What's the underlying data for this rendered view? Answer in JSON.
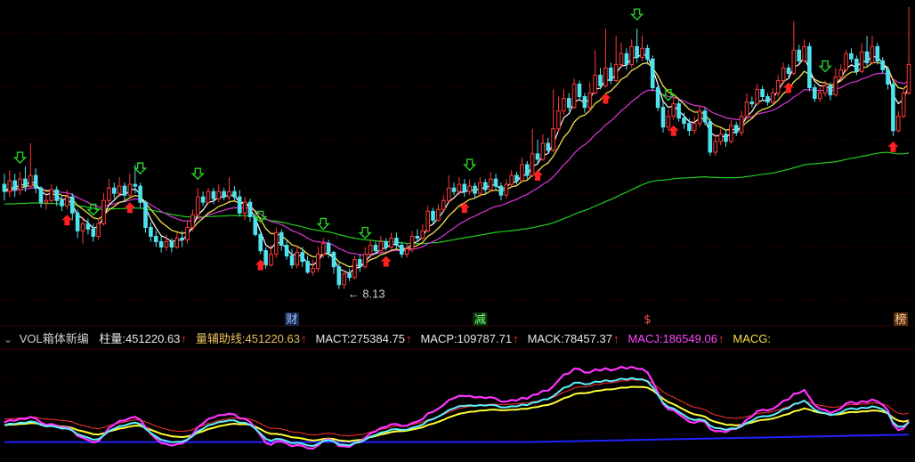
{
  "colors": {
    "background": "#000000",
    "grid": "#5a0000",
    "up_candle": "#ff3a3a",
    "down_candle": "#4fe3f0",
    "ma_short": "#ffffff",
    "ma_mid": "#f2e04a",
    "ma_long": "#cc33cc",
    "ma_longest": "#22cc22",
    "buy_arrow": "#ff2020",
    "sell_arrow": "#28d028",
    "macd_t": "#ff3030",
    "macd_p": "#ff33ff",
    "macd_k": "#5ff0ff",
    "macd_j": "#ffff33",
    "macd_g": "#2222ff"
  },
  "info_bar": {
    "toggle_icon": "chevron-down-icon",
    "indicator_name": "VOL箱体新编",
    "fields": [
      {
        "label": "柱量: ",
        "value": "451220.63",
        "color": "#e8e8e8",
        "arrow": "↑"
      },
      {
        "label": "量辅助线: ",
        "value": "451220.63",
        "color": "#e8c060",
        "arrow": "↑"
      },
      {
        "label": "MACT: ",
        "value": "275384.75",
        "color": "#e8e8e8",
        "arrow": "↑"
      },
      {
        "label": "MACP: ",
        "value": "109787.71",
        "color": "#e8e8e8",
        "arrow": "↑"
      },
      {
        "label": "MACK: ",
        "value": "78457.37",
        "color": "#e8e8e8",
        "arrow": "↑"
      },
      {
        "label": "MACJ: ",
        "value": "186549.06",
        "color": "#ff44ff",
        "arrow": "↑"
      },
      {
        "label": "MACG: ",
        "value": "",
        "color": "#f2e04a",
        "arrow": ""
      }
    ]
  },
  "event_tags": [
    {
      "text": "财",
      "candle_index": 55,
      "color": "#9fc8ff",
      "bg": "#1a2a50"
    },
    {
      "text": "减",
      "candle_index": 91,
      "color": "#7fff7f",
      "bg": "#0d3a0d"
    },
    {
      "text": "$",
      "candle_index": 123,
      "color": "#ff5050",
      "bg": "#000000"
    },
    {
      "text": "榜",
      "candle_index": 182,
      "color": "#ffcc99",
      "bg": "#5a3010"
    }
  ],
  "chart_data": {
    "type": "candlestick",
    "price_range": [
      7.3,
      16.0
    ],
    "low_annotation": {
      "text": "← 8.13",
      "candle_index": 65,
      "price": 8.13
    },
    "candles": [
      [
        11.05,
        10.85,
        11.35,
        10.6
      ],
      [
        10.85,
        11.15,
        11.45,
        10.7
      ],
      [
        11.15,
        10.9,
        11.35,
        10.7
      ],
      [
        10.9,
        11.2,
        11.4,
        10.75
      ],
      [
        11.2,
        11.0,
        11.55,
        10.85
      ],
      [
        11.0,
        11.3,
        12.2,
        10.95
      ],
      [
        11.3,
        10.95,
        11.5,
        10.8
      ],
      [
        10.95,
        10.55,
        11.0,
        10.4
      ],
      [
        10.55,
        10.6,
        10.8,
        10.35
      ],
      [
        10.6,
        10.9,
        11.05,
        10.5
      ],
      [
        10.9,
        10.6,
        11.0,
        10.45
      ],
      [
        10.6,
        10.45,
        10.75,
        10.3
      ],
      [
        10.45,
        10.7,
        10.9,
        10.35
      ],
      [
        10.7,
        10.25,
        10.8,
        10.05
      ],
      [
        10.25,
        9.75,
        10.35,
        9.55
      ],
      [
        9.75,
        9.95,
        10.15,
        9.4
      ],
      [
        9.95,
        9.8,
        10.1,
        9.65
      ],
      [
        9.8,
        9.6,
        9.95,
        9.45
      ],
      [
        9.6,
        9.95,
        10.1,
        9.5
      ],
      [
        9.95,
        10.6,
        10.8,
        9.9
      ],
      [
        10.6,
        10.95,
        11.2,
        10.5
      ],
      [
        10.95,
        10.8,
        11.1,
        10.65
      ],
      [
        10.8,
        11.0,
        11.25,
        10.7
      ],
      [
        11.0,
        10.75,
        11.1,
        10.55
      ],
      [
        10.75,
        11.05,
        11.35,
        10.7
      ],
      [
        11.05,
        11.0,
        11.6,
        10.8
      ],
      [
        11.0,
        10.55,
        11.1,
        10.4
      ],
      [
        10.55,
        9.85,
        10.6,
        9.7
      ],
      [
        9.85,
        9.6,
        10.0,
        9.45
      ],
      [
        9.6,
        9.45,
        9.75,
        9.3
      ],
      [
        9.45,
        9.3,
        9.6,
        9.15
      ],
      [
        9.3,
        9.45,
        9.65,
        9.2
      ],
      [
        9.45,
        9.3,
        9.55,
        9.15
      ],
      [
        9.3,
        9.55,
        9.7,
        9.25
      ],
      [
        9.55,
        9.5,
        9.75,
        9.3
      ],
      [
        9.5,
        9.85,
        10.05,
        9.4
      ],
      [
        9.85,
        10.2,
        10.35,
        9.75
      ],
      [
        10.2,
        10.7,
        10.95,
        10.1
      ],
      [
        10.7,
        10.55,
        10.85,
        10.45
      ],
      [
        10.55,
        10.85,
        10.95,
        10.5
      ],
      [
        10.85,
        10.65,
        10.95,
        10.5
      ],
      [
        10.65,
        10.85,
        11.05,
        10.55
      ],
      [
        10.85,
        10.7,
        10.95,
        10.6
      ],
      [
        10.7,
        10.85,
        11.25,
        10.6
      ],
      [
        10.85,
        10.7,
        11.0,
        10.6
      ],
      [
        10.7,
        10.25,
        10.9,
        10.15
      ],
      [
        10.25,
        10.55,
        10.7,
        10.05
      ],
      [
        10.55,
        10.15,
        10.65,
        10.0
      ],
      [
        10.15,
        9.65,
        10.25,
        9.6
      ],
      [
        9.65,
        9.2,
        9.75,
        9.1
      ],
      [
        9.2,
        8.8,
        9.3,
        8.7
      ],
      [
        8.8,
        9.1,
        9.35,
        8.75
      ],
      [
        9.1,
        9.7,
        9.85,
        9.0
      ],
      [
        9.7,
        9.35,
        9.8,
        9.2
      ],
      [
        9.35,
        9.05,
        9.5,
        8.95
      ],
      [
        9.05,
        8.8,
        9.25,
        8.7
      ],
      [
        8.8,
        9.15,
        9.35,
        8.7
      ],
      [
        9.15,
        8.9,
        9.3,
        8.75
      ],
      [
        8.9,
        8.6,
        9.05,
        8.55
      ],
      [
        8.6,
        8.7,
        8.95,
        8.5
      ],
      [
        8.7,
        9.1,
        9.3,
        8.6
      ],
      [
        9.1,
        9.4,
        9.55,
        9.0
      ],
      [
        9.4,
        9.15,
        9.5,
        9.0
      ],
      [
        9.15,
        8.75,
        9.2,
        8.55
      ],
      [
        8.75,
        8.25,
        8.85,
        8.13
      ],
      [
        8.25,
        8.55,
        8.65,
        8.13
      ],
      [
        8.55,
        8.45,
        8.7,
        8.35
      ],
      [
        8.45,
        8.95,
        9.05,
        8.4
      ],
      [
        8.95,
        8.75,
        9.1,
        8.6
      ],
      [
        8.75,
        9.1,
        9.3,
        8.7
      ],
      [
        9.1,
        9.35,
        9.5,
        9.0
      ],
      [
        9.35,
        9.2,
        9.45,
        9.1
      ],
      [
        9.2,
        9.45,
        9.6,
        9.15
      ],
      [
        9.45,
        9.3,
        9.55,
        9.2
      ],
      [
        9.3,
        9.55,
        9.7,
        9.25
      ],
      [
        9.55,
        9.35,
        9.7,
        9.25
      ],
      [
        9.35,
        9.1,
        9.45,
        9.0
      ],
      [
        9.1,
        9.25,
        9.4,
        9.0
      ],
      [
        9.25,
        9.6,
        9.75,
        9.15
      ],
      [
        9.6,
        9.55,
        9.8,
        9.45
      ],
      [
        9.55,
        9.75,
        9.95,
        9.5
      ],
      [
        9.75,
        10.3,
        10.45,
        9.7
      ],
      [
        10.3,
        10.05,
        10.4,
        9.95
      ],
      [
        10.05,
        10.35,
        10.5,
        10.0
      ],
      [
        10.35,
        10.6,
        10.75,
        10.3
      ],
      [
        10.6,
        10.95,
        11.3,
        10.55
      ],
      [
        10.95,
        10.85,
        11.1,
        10.75
      ],
      [
        10.85,
        11.05,
        11.25,
        10.75
      ],
      [
        11.05,
        10.85,
        11.2,
        10.7
      ],
      [
        10.85,
        11.0,
        11.2,
        10.75
      ],
      [
        11.0,
        10.8,
        11.1,
        10.65
      ],
      [
        10.8,
        11.1,
        11.25,
        10.7
      ],
      [
        11.1,
        10.9,
        11.2,
        10.8
      ],
      [
        10.9,
        11.2,
        11.4,
        10.85
      ],
      [
        11.2,
        11.0,
        11.35,
        10.9
      ],
      [
        11.0,
        10.75,
        11.1,
        10.6
      ],
      [
        10.75,
        11.05,
        11.2,
        10.65
      ],
      [
        11.05,
        11.3,
        11.45,
        11.0
      ],
      [
        11.3,
        11.15,
        11.4,
        11.05
      ],
      [
        11.15,
        11.6,
        11.8,
        11.1
      ],
      [
        11.6,
        11.3,
        11.7,
        11.2
      ],
      [
        11.3,
        11.9,
        12.6,
        11.25
      ],
      [
        11.9,
        11.75,
        12.3,
        11.6
      ],
      [
        11.75,
        12.2,
        12.45,
        11.7
      ],
      [
        12.2,
        12.0,
        12.35,
        11.9
      ],
      [
        12.0,
        12.6,
        13.7,
        11.95
      ],
      [
        12.6,
        13.1,
        13.5,
        12.5
      ],
      [
        13.1,
        13.45,
        13.7,
        13.0
      ],
      [
        13.45,
        13.2,
        13.6,
        13.1
      ],
      [
        13.2,
        13.85,
        14.0,
        13.15
      ],
      [
        13.85,
        13.5,
        13.95,
        13.4
      ],
      [
        13.5,
        13.2,
        13.6,
        13.05
      ],
      [
        13.2,
        13.6,
        13.9,
        13.1
      ],
      [
        13.6,
        14.1,
        14.8,
        13.55
      ],
      [
        14.1,
        13.8,
        14.3,
        13.7
      ],
      [
        13.8,
        14.3,
        15.4,
        13.75
      ],
      [
        14.3,
        13.95,
        14.45,
        13.85
      ],
      [
        13.95,
        14.4,
        15.2,
        13.9
      ],
      [
        14.4,
        14.7,
        15.0,
        14.3
      ],
      [
        14.7,
        14.4,
        14.85,
        14.25
      ],
      [
        14.4,
        14.9,
        15.1,
        14.3
      ],
      [
        14.9,
        14.6,
        15.4,
        14.45
      ],
      [
        14.6,
        14.85,
        15.2,
        14.5
      ],
      [
        14.85,
        14.55,
        14.95,
        14.4
      ],
      [
        14.55,
        13.75,
        14.65,
        13.65
      ],
      [
        13.75,
        13.2,
        13.85,
        13.1
      ],
      [
        13.2,
        12.65,
        13.35,
        12.5
      ],
      [
        12.65,
        12.95,
        13.15,
        12.55
      ],
      [
        12.95,
        13.3,
        13.5,
        12.85
      ],
      [
        13.3,
        12.9,
        13.45,
        12.8
      ],
      [
        12.9,
        12.75,
        13.05,
        12.6
      ],
      [
        12.75,
        12.55,
        12.9,
        12.4
      ],
      [
        12.55,
        12.75,
        12.95,
        12.45
      ],
      [
        12.75,
        13.1,
        13.25,
        12.65
      ],
      [
        13.1,
        12.8,
        13.2,
        12.7
      ],
      [
        12.8,
        11.95,
        12.9,
        11.85
      ],
      [
        11.95,
        12.25,
        12.45,
        11.85
      ],
      [
        12.25,
        12.45,
        12.6,
        12.15
      ],
      [
        12.45,
        12.25,
        12.55,
        12.1
      ],
      [
        12.25,
        12.7,
        12.85,
        12.2
      ],
      [
        12.7,
        12.5,
        12.8,
        12.4
      ],
      [
        12.5,
        12.95,
        13.1,
        12.4
      ],
      [
        12.95,
        13.35,
        13.6,
        12.9
      ],
      [
        13.35,
        13.3,
        13.5,
        13.2
      ],
      [
        13.3,
        13.7,
        13.85,
        13.25
      ],
      [
        13.7,
        13.5,
        13.8,
        13.4
      ],
      [
        13.5,
        13.35,
        13.6,
        13.25
      ],
      [
        13.35,
        13.6,
        13.75,
        13.3
      ],
      [
        13.6,
        13.95,
        14.1,
        13.5
      ],
      [
        13.95,
        14.3,
        14.45,
        13.85
      ],
      [
        14.3,
        14.15,
        14.4,
        14.05
      ],
      [
        14.15,
        14.8,
        15.6,
        14.1
      ],
      [
        14.8,
        14.5,
        14.95,
        14.4
      ],
      [
        14.5,
        14.9,
        15.1,
        14.45
      ],
      [
        14.9,
        13.75,
        15.0,
        13.65
      ],
      [
        13.75,
        13.45,
        13.85,
        13.35
      ],
      [
        13.45,
        13.6,
        13.75,
        13.35
      ],
      [
        13.6,
        13.8,
        13.95,
        13.5
      ],
      [
        13.8,
        13.55,
        13.9,
        13.4
      ],
      [
        13.55,
        14.05,
        14.3,
        13.5
      ],
      [
        14.05,
        14.25,
        14.4,
        13.95
      ],
      [
        14.25,
        14.7,
        14.8,
        14.2
      ],
      [
        14.7,
        14.55,
        14.85,
        14.45
      ],
      [
        14.55,
        14.2,
        14.65,
        14.1
      ],
      [
        14.2,
        14.75,
        15.0,
        14.15
      ],
      [
        14.75,
        14.45,
        15.2,
        14.35
      ],
      [
        14.45,
        14.9,
        15.2,
        14.4
      ],
      [
        14.9,
        14.5,
        15.0,
        14.4
      ],
      [
        14.5,
        14.25,
        14.6,
        14.15
      ],
      [
        14.25,
        13.85,
        14.35,
        13.7
      ],
      [
        13.85,
        12.55,
        13.95,
        12.4
      ],
      [
        12.55,
        12.95,
        13.1,
        12.5
      ],
      [
        12.95,
        13.6,
        13.75,
        12.9
      ],
      [
        13.6,
        14.4,
        16.0,
        13.55
      ]
    ],
    "sell_arrows": [
      3,
      17,
      26,
      37,
      49,
      61,
      69,
      89,
      121,
      127,
      157,
      175
    ],
    "buy_arrows": [
      12,
      24,
      49,
      73,
      88,
      102,
      115,
      128,
      150,
      170,
      183
    ]
  }
}
